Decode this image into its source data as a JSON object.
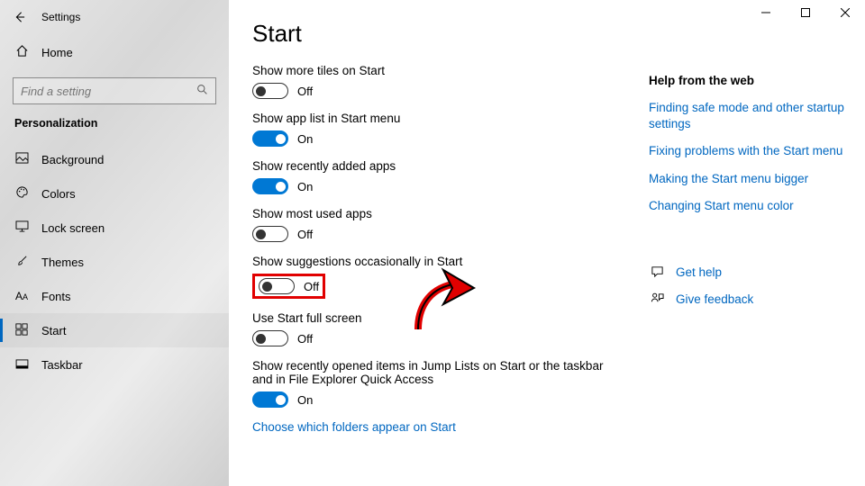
{
  "window": {
    "title": "Settings"
  },
  "sidebar": {
    "home_label": "Home",
    "search_placeholder": "Find a setting",
    "section": "Personalization",
    "items": [
      {
        "label": "Background"
      },
      {
        "label": "Colors"
      },
      {
        "label": "Lock screen"
      },
      {
        "label": "Themes"
      },
      {
        "label": "Fonts"
      },
      {
        "label": "Start"
      },
      {
        "label": "Taskbar"
      }
    ]
  },
  "page": {
    "heading": "Start",
    "settings": [
      {
        "label": "Show more tiles on Start",
        "state": "Off"
      },
      {
        "label": "Show app list in Start menu",
        "state": "On"
      },
      {
        "label": "Show recently added apps",
        "state": "On"
      },
      {
        "label": "Show most used apps",
        "state": "Off"
      },
      {
        "label": "Show suggestions occasionally in Start",
        "state": "Off"
      },
      {
        "label": "Use Start full screen",
        "state": "Off"
      },
      {
        "label": "Show recently opened items in Jump Lists on Start or the taskbar and in File Explorer Quick Access",
        "state": "On"
      }
    ],
    "footer_link": "Choose which folders appear on Start"
  },
  "help": {
    "heading": "Help from the web",
    "links": [
      "Finding safe mode and other startup settings",
      "Fixing problems with the Start menu",
      "Making the Start menu bigger",
      "Changing Start menu color"
    ],
    "actions": [
      {
        "label": "Get help"
      },
      {
        "label": "Give feedback"
      }
    ]
  },
  "colors": {
    "accent": "#0078d4",
    "link": "#0067c0",
    "highlight": "#e10000"
  }
}
